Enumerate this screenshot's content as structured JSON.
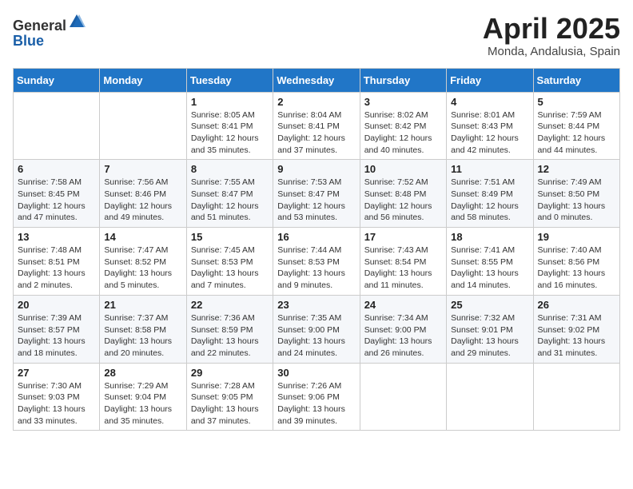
{
  "header": {
    "logo_general": "General",
    "logo_blue": "Blue",
    "month_year": "April 2025",
    "location": "Monda, Andalusia, Spain"
  },
  "weekdays": [
    "Sunday",
    "Monday",
    "Tuesday",
    "Wednesday",
    "Thursday",
    "Friday",
    "Saturday"
  ],
  "weeks": [
    [
      null,
      null,
      {
        "day": "1",
        "sunrise": "8:05 AM",
        "sunset": "8:41 PM",
        "daylight": "12 hours and 35 minutes."
      },
      {
        "day": "2",
        "sunrise": "8:04 AM",
        "sunset": "8:41 PM",
        "daylight": "12 hours and 37 minutes."
      },
      {
        "day": "3",
        "sunrise": "8:02 AM",
        "sunset": "8:42 PM",
        "daylight": "12 hours and 40 minutes."
      },
      {
        "day": "4",
        "sunrise": "8:01 AM",
        "sunset": "8:43 PM",
        "daylight": "12 hours and 42 minutes."
      },
      {
        "day": "5",
        "sunrise": "7:59 AM",
        "sunset": "8:44 PM",
        "daylight": "12 hours and 44 minutes."
      }
    ],
    [
      {
        "day": "6",
        "sunrise": "7:58 AM",
        "sunset": "8:45 PM",
        "daylight": "12 hours and 47 minutes."
      },
      {
        "day": "7",
        "sunrise": "7:56 AM",
        "sunset": "8:46 PM",
        "daylight": "12 hours and 49 minutes."
      },
      {
        "day": "8",
        "sunrise": "7:55 AM",
        "sunset": "8:47 PM",
        "daylight": "12 hours and 51 minutes."
      },
      {
        "day": "9",
        "sunrise": "7:53 AM",
        "sunset": "8:47 PM",
        "daylight": "12 hours and 53 minutes."
      },
      {
        "day": "10",
        "sunrise": "7:52 AM",
        "sunset": "8:48 PM",
        "daylight": "12 hours and 56 minutes."
      },
      {
        "day": "11",
        "sunrise": "7:51 AM",
        "sunset": "8:49 PM",
        "daylight": "12 hours and 58 minutes."
      },
      {
        "day": "12",
        "sunrise": "7:49 AM",
        "sunset": "8:50 PM",
        "daylight": "13 hours and 0 minutes."
      }
    ],
    [
      {
        "day": "13",
        "sunrise": "7:48 AM",
        "sunset": "8:51 PM",
        "daylight": "13 hours and 2 minutes."
      },
      {
        "day": "14",
        "sunrise": "7:47 AM",
        "sunset": "8:52 PM",
        "daylight": "13 hours and 5 minutes."
      },
      {
        "day": "15",
        "sunrise": "7:45 AM",
        "sunset": "8:53 PM",
        "daylight": "13 hours and 7 minutes."
      },
      {
        "day": "16",
        "sunrise": "7:44 AM",
        "sunset": "8:53 PM",
        "daylight": "13 hours and 9 minutes."
      },
      {
        "day": "17",
        "sunrise": "7:43 AM",
        "sunset": "8:54 PM",
        "daylight": "13 hours and 11 minutes."
      },
      {
        "day": "18",
        "sunrise": "7:41 AM",
        "sunset": "8:55 PM",
        "daylight": "13 hours and 14 minutes."
      },
      {
        "day": "19",
        "sunrise": "7:40 AM",
        "sunset": "8:56 PM",
        "daylight": "13 hours and 16 minutes."
      }
    ],
    [
      {
        "day": "20",
        "sunrise": "7:39 AM",
        "sunset": "8:57 PM",
        "daylight": "13 hours and 18 minutes."
      },
      {
        "day": "21",
        "sunrise": "7:37 AM",
        "sunset": "8:58 PM",
        "daylight": "13 hours and 20 minutes."
      },
      {
        "day": "22",
        "sunrise": "7:36 AM",
        "sunset": "8:59 PM",
        "daylight": "13 hours and 22 minutes."
      },
      {
        "day": "23",
        "sunrise": "7:35 AM",
        "sunset": "9:00 PM",
        "daylight": "13 hours and 24 minutes."
      },
      {
        "day": "24",
        "sunrise": "7:34 AM",
        "sunset": "9:00 PM",
        "daylight": "13 hours and 26 minutes."
      },
      {
        "day": "25",
        "sunrise": "7:32 AM",
        "sunset": "9:01 PM",
        "daylight": "13 hours and 29 minutes."
      },
      {
        "day": "26",
        "sunrise": "7:31 AM",
        "sunset": "9:02 PM",
        "daylight": "13 hours and 31 minutes."
      }
    ],
    [
      {
        "day": "27",
        "sunrise": "7:30 AM",
        "sunset": "9:03 PM",
        "daylight": "13 hours and 33 minutes."
      },
      {
        "day": "28",
        "sunrise": "7:29 AM",
        "sunset": "9:04 PM",
        "daylight": "13 hours and 35 minutes."
      },
      {
        "day": "29",
        "sunrise": "7:28 AM",
        "sunset": "9:05 PM",
        "daylight": "13 hours and 37 minutes."
      },
      {
        "day": "30",
        "sunrise": "7:26 AM",
        "sunset": "9:06 PM",
        "daylight": "13 hours and 39 minutes."
      },
      null,
      null,
      null
    ]
  ]
}
